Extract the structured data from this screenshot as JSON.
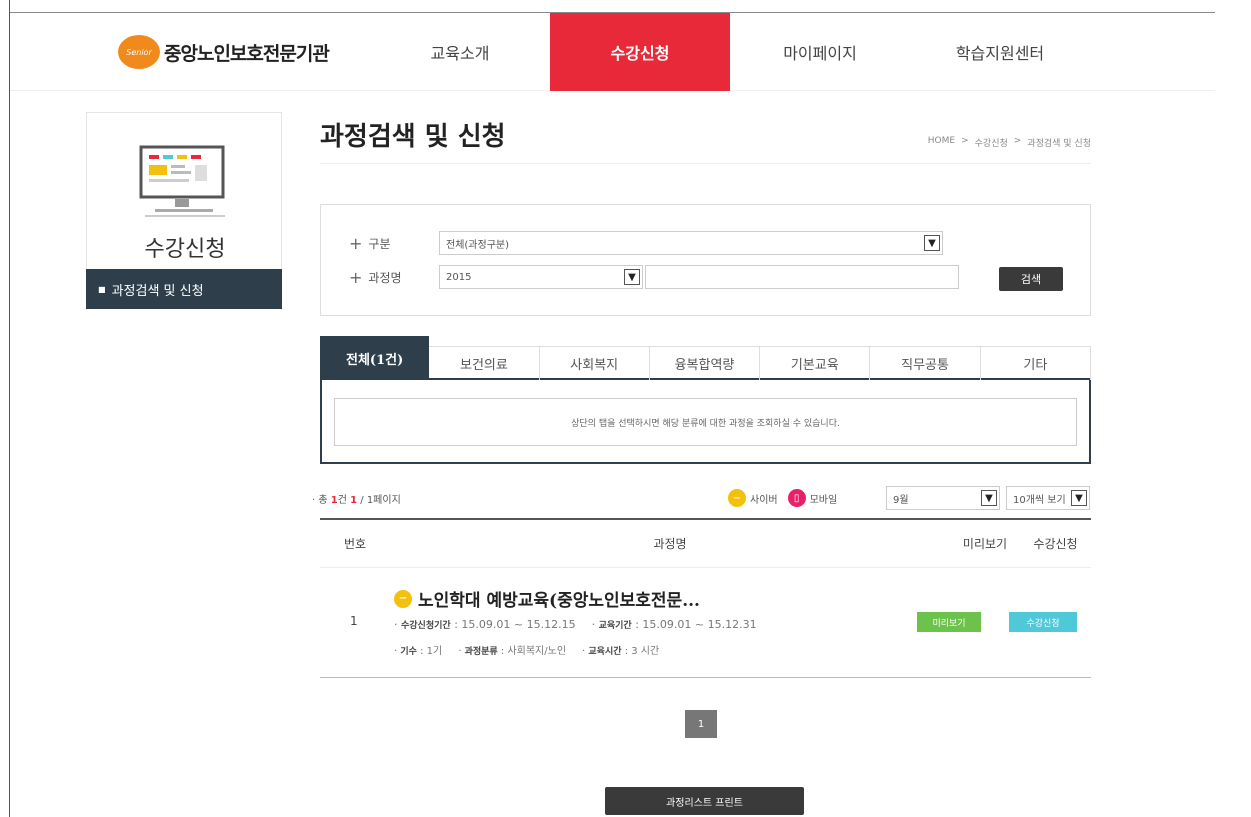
{
  "header": {
    "logo_badge": "Senior",
    "logo_text": "중앙노인보호전문기관",
    "nav": [
      {
        "label": "교육소개"
      },
      {
        "label": "수강신청"
      },
      {
        "label": "마이페이지"
      },
      {
        "label": "학습지원센터"
      }
    ],
    "active_nav": "수강신청",
    "accent_color": "#e8293a"
  },
  "sidebar": {
    "title": "수강신청",
    "menu_item": "과정검색 및 신청",
    "menu_bg": "#2e3f4b"
  },
  "page": {
    "title": "과정검색 및 신청",
    "breadcrumb": [
      "HOME",
      ">",
      "수강신청",
      ">",
      "과정검색 및 신청"
    ]
  },
  "search": {
    "category_label": "구분",
    "category_value": "전체(과정구분)",
    "course_label": "과정명",
    "year_value": "2015",
    "keyword_value": "",
    "search_button": "검색"
  },
  "tabs": [
    {
      "label": "전체(1건)",
      "active": true
    },
    {
      "label": "보건의료"
    },
    {
      "label": "사회복지"
    },
    {
      "label": "융복합역량"
    },
    {
      "label": "기본교육"
    },
    {
      "label": "직무공통"
    },
    {
      "label": "기타"
    }
  ],
  "tab_message": "상단의 탭을 선택하시면 해당 분류에 대한 과정을 조회하실 수 있습니다.",
  "list_info": {
    "total_prefix": "총",
    "total_count": "1",
    "total_unit": "건",
    "page_current": "1",
    "page_rest": "/ 1페이지",
    "legend_cyber": "사이버",
    "legend_mobile": "모바일",
    "month_select": "9월",
    "view_select": "10개씩 보기"
  },
  "table": {
    "headers": [
      "번호",
      "과정명",
      "미리보기",
      "수강신청"
    ],
    "rows": [
      {
        "no": "1",
        "title": "노인학대 예방교육(중앙노인보호전문...",
        "apply_period_label": "수강신청기간",
        "apply_period": ": 15.09.01 ~ 15.12.15",
        "edu_period_label": "교육기간",
        "edu_period": ": 15.09.01 ~ 15.12.31",
        "term_label": "기수",
        "term": ": 1기",
        "category_label": "과정분류",
        "category": ": 사회복지/노인",
        "hours_label": "교육시간",
        "hours": ": 3 시간",
        "preview_btn": "미리보기",
        "apply_btn": "수강신청"
      }
    ]
  },
  "pager": {
    "current": "1"
  },
  "print_button": "과정리스트 프린트",
  "icons": {
    "cyber": "cyber-icon",
    "mobile": "mobile-icon",
    "plus": "plus-icon",
    "chevron": "chevron-down-icon"
  }
}
